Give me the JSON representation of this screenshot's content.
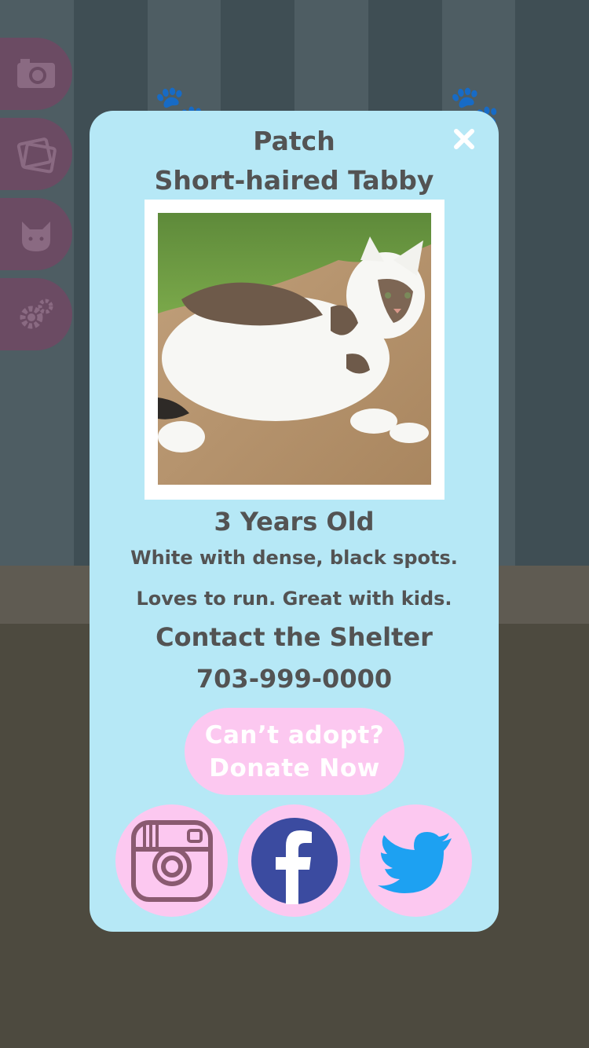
{
  "pet": {
    "name": "Patch",
    "breed": "Short-haired Tabby",
    "age": "3 Years Old",
    "description_line1": "White with dense, black spots.",
    "description_line2": "Loves to run. Great with kids."
  },
  "contact": {
    "heading": "Contact the Shelter",
    "phone": "703-999-0000"
  },
  "donate": {
    "line1": "Can’t adopt?",
    "line2": "Donate Now"
  },
  "side_menu": [
    {
      "icon": "camera-icon"
    },
    {
      "icon": "photos-icon"
    },
    {
      "icon": "cat-icon"
    },
    {
      "icon": "gear-icon"
    }
  ],
  "social": [
    {
      "icon": "instagram-icon"
    },
    {
      "icon": "facebook-icon"
    },
    {
      "icon": "twitter-icon"
    }
  ],
  "colors": {
    "modal_bg": "#b6e8f6",
    "text": "#535353",
    "pink": "#fcc8f0",
    "menu_tab": "#6b4b63",
    "facebook": "#3b4ba0",
    "twitter": "#1da1f2",
    "instagram": "#8a5a70"
  }
}
